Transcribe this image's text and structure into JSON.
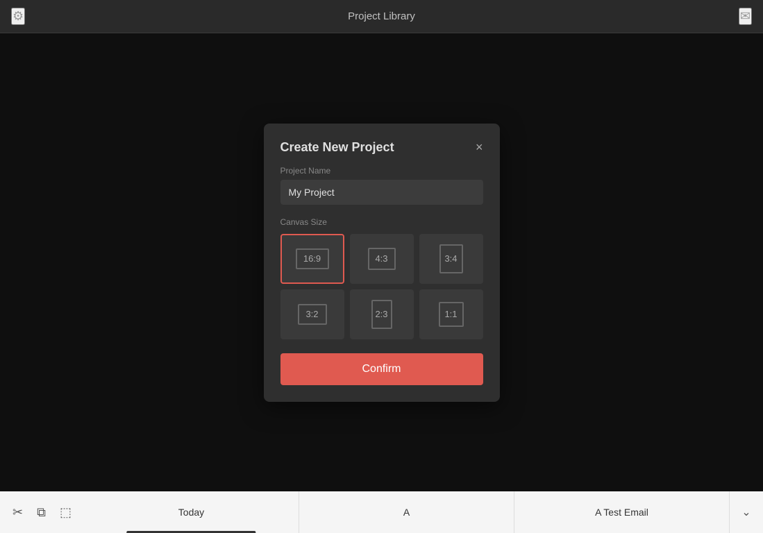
{
  "topbar": {
    "title": "Project Library",
    "gear_icon": "⚙",
    "inbox_icon": "✉"
  },
  "modal": {
    "title": "Create New Project",
    "close_icon": "×",
    "project_name_label": "Project Name",
    "project_name_value": "My Project",
    "canvas_size_label": "Canvas Size",
    "ratios": [
      {
        "id": "16:9",
        "label": "16:9",
        "selected": true,
        "inner_class": "ratio-inner-16-9"
      },
      {
        "id": "4:3",
        "label": "4:3",
        "selected": false,
        "inner_class": "ratio-inner-4-3"
      },
      {
        "id": "3:4",
        "label": "3:4",
        "selected": false,
        "inner_class": "ratio-inner-3-4"
      },
      {
        "id": "3:2",
        "label": "3:2",
        "selected": false,
        "inner_class": "ratio-inner-3-2"
      },
      {
        "id": "2:3",
        "label": "2:3",
        "selected": false,
        "inner_class": "ratio-inner-2-3"
      },
      {
        "id": "1:1",
        "label": "1:1",
        "selected": false,
        "inner_class": "ratio-inner-1-1"
      }
    ],
    "confirm_label": "Confirm"
  },
  "bottombar": {
    "tools": [
      "✂",
      "⧉",
      "⬚"
    ],
    "tabs": [
      {
        "label": "Today",
        "active": true
      },
      {
        "label": "A",
        "active": false
      },
      {
        "label": "A Test Email",
        "active": false
      }
    ],
    "arrow_icon": "⌄"
  },
  "colors": {
    "selected_border": "#e05a50",
    "confirm_bg": "#e05a50"
  }
}
